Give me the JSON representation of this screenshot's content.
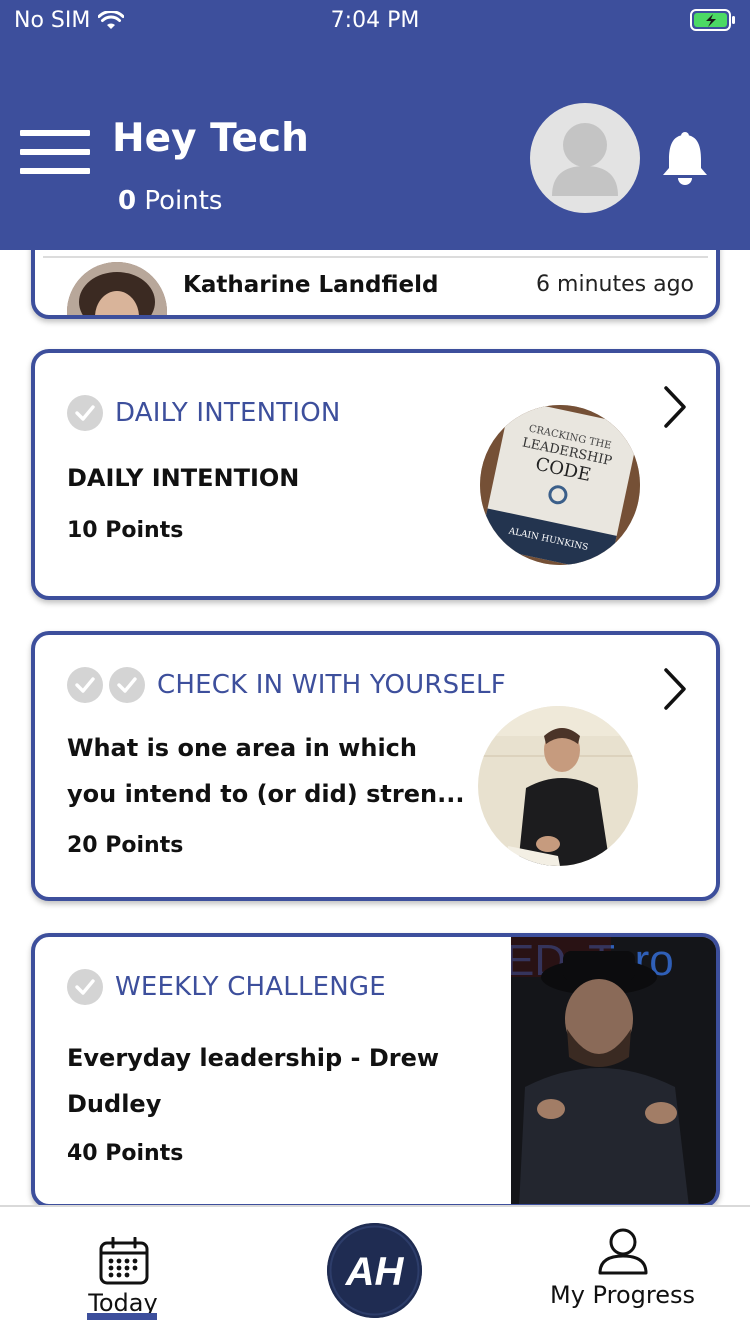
{
  "status_bar": {
    "carrier": "No SIM",
    "time": "7:04 PM"
  },
  "header": {
    "greeting": "Hey Tech",
    "points_value": "0",
    "points_label": "Points"
  },
  "feed": {
    "top_post": {
      "author": "Katharine Landfield",
      "time_ago": "6 minutes ago"
    },
    "cards": [
      {
        "category": "DAILY INTENTION",
        "title_lines": [
          "DAILY INTENTION"
        ],
        "points": "10 Points",
        "thumbnail_icon": "book-cover-image"
      },
      {
        "category": "CHECK IN WITH YOURSELF",
        "title_lines": [
          "What is one area in which",
          "you intend to (or did) stren..."
        ],
        "points": "20 Points",
        "thumbnail_icon": "man-writing-image"
      },
      {
        "category": "WEEKLY CHALLENGE",
        "title_lines": [
          "Everyday leadership - Drew",
          "Dudley"
        ],
        "points": "40 Points",
        "thumbnail_icon": "speaker-video-image"
      }
    ]
  },
  "book_cover": {
    "line1": "CRACKING THE",
    "line2": "LEADERSHIP",
    "line3": "CODE",
    "author": "ALAIN HUNKINS"
  },
  "video_backdrop_text": "EDxToro",
  "tabbar": {
    "today_label": "Today",
    "logo_text": "AH",
    "progress_label": "My Progress"
  },
  "colors": {
    "brand": "#3d4f9c",
    "check_gray": "#d4d4d4"
  }
}
